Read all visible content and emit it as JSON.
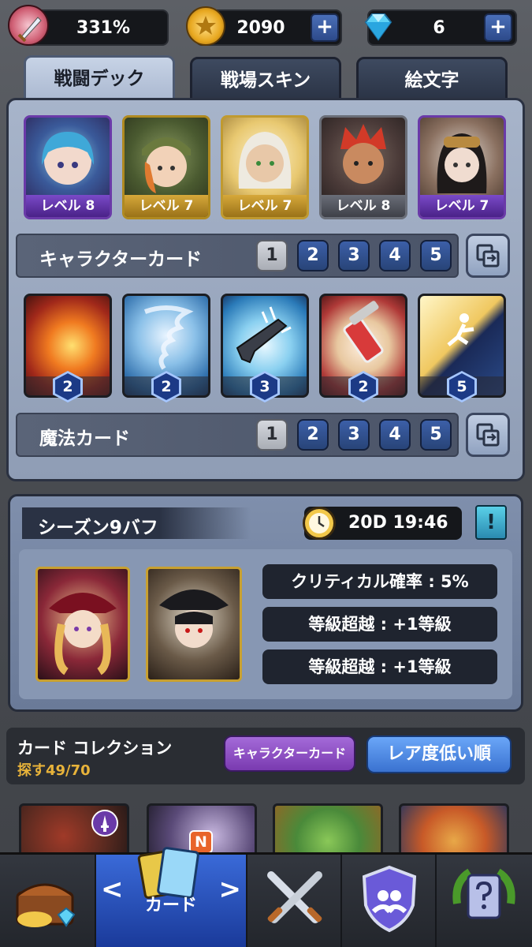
{
  "top_bar": {
    "power_value": "331%",
    "gold_value": "2090",
    "gem_value": "6",
    "plus_label": "+"
  },
  "tabs": [
    {
      "label": "戦闘デック",
      "active": true
    },
    {
      "label": "戦場スキン",
      "active": false
    },
    {
      "label": "絵文字",
      "active": false
    }
  ],
  "character_cards": [
    {
      "level": "レベル 8",
      "frame": "purple"
    },
    {
      "level": "レベル 7",
      "frame": "gold"
    },
    {
      "level": "レベル 7",
      "frame": "gold"
    },
    {
      "level": "レベル 8",
      "frame": "gray"
    },
    {
      "level": "レベル 7",
      "frame": "purple"
    }
  ],
  "character_section": {
    "label": "キャラクターカード",
    "deck_numbers": [
      "1",
      "2",
      "3",
      "4",
      "5"
    ],
    "selected": "1"
  },
  "magic_cards": [
    {
      "cost": "2",
      "theme": "fire"
    },
    {
      "cost": "2",
      "theme": "tornado"
    },
    {
      "cost": "3",
      "theme": "ice-gun"
    },
    {
      "cost": "2",
      "theme": "syringe"
    },
    {
      "cost": "5",
      "theme": "escape"
    }
  ],
  "magic_section": {
    "label": "魔法カード",
    "deck_numbers": [
      "1",
      "2",
      "3",
      "4",
      "5"
    ],
    "selected": "1"
  },
  "season": {
    "title": "シーズン9バフ",
    "timer": "20D 19:46",
    "info_icon": "!",
    "stats": [
      "クリティカル確率 : 5%",
      "等級超越 : +1等級",
      "等級超越 : +1等級"
    ]
  },
  "collection": {
    "title": "カード コレクション",
    "progress": "探す49/70",
    "filter_button": "キャラクターカード",
    "sort_button": "レア度低い順"
  },
  "collection_badges": {
    "new_badge": "N"
  },
  "bottom_nav": {
    "active_label": "カード",
    "prev": "<",
    "next": ">"
  },
  "colors": {
    "accent_blue": "#3c5fa8",
    "purple_button": "#8a4fc0",
    "sort_button": "#4a86e8",
    "gold": "#e8b33a"
  }
}
